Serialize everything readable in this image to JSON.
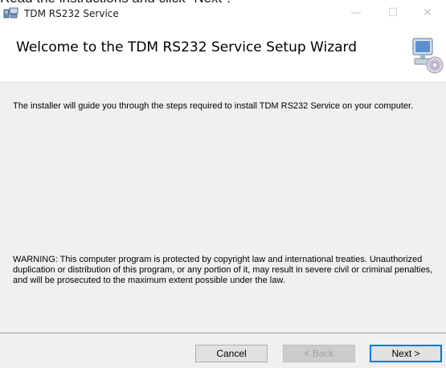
{
  "overlay": {
    "caption": "Read the instructions and click \"Next\"."
  },
  "window": {
    "title": "TDM RS232 Service",
    "controls": {
      "minimize": "—",
      "maximize": "☐",
      "close": "✕"
    }
  },
  "header": {
    "heading": "Welcome to the TDM RS232 Service Setup Wizard",
    "icon": "computer-with-disc-icon"
  },
  "body": {
    "intro": "The installer will guide you through the steps required to install TDM RS232 Service on your computer.",
    "warning": "WARNING: This computer program is protected by copyright law and international treaties. Unauthorized duplication or distribution of this program, or any portion of it, may result in severe civil or criminal penalties, and will be prosecuted to the maximum extent possible under the law."
  },
  "footer": {
    "cancel_label": "Cancel",
    "back_label": "< Back",
    "next_label": "Next >"
  },
  "colors": {
    "accent": "#0078d7",
    "panel": "#f0f0f0"
  }
}
